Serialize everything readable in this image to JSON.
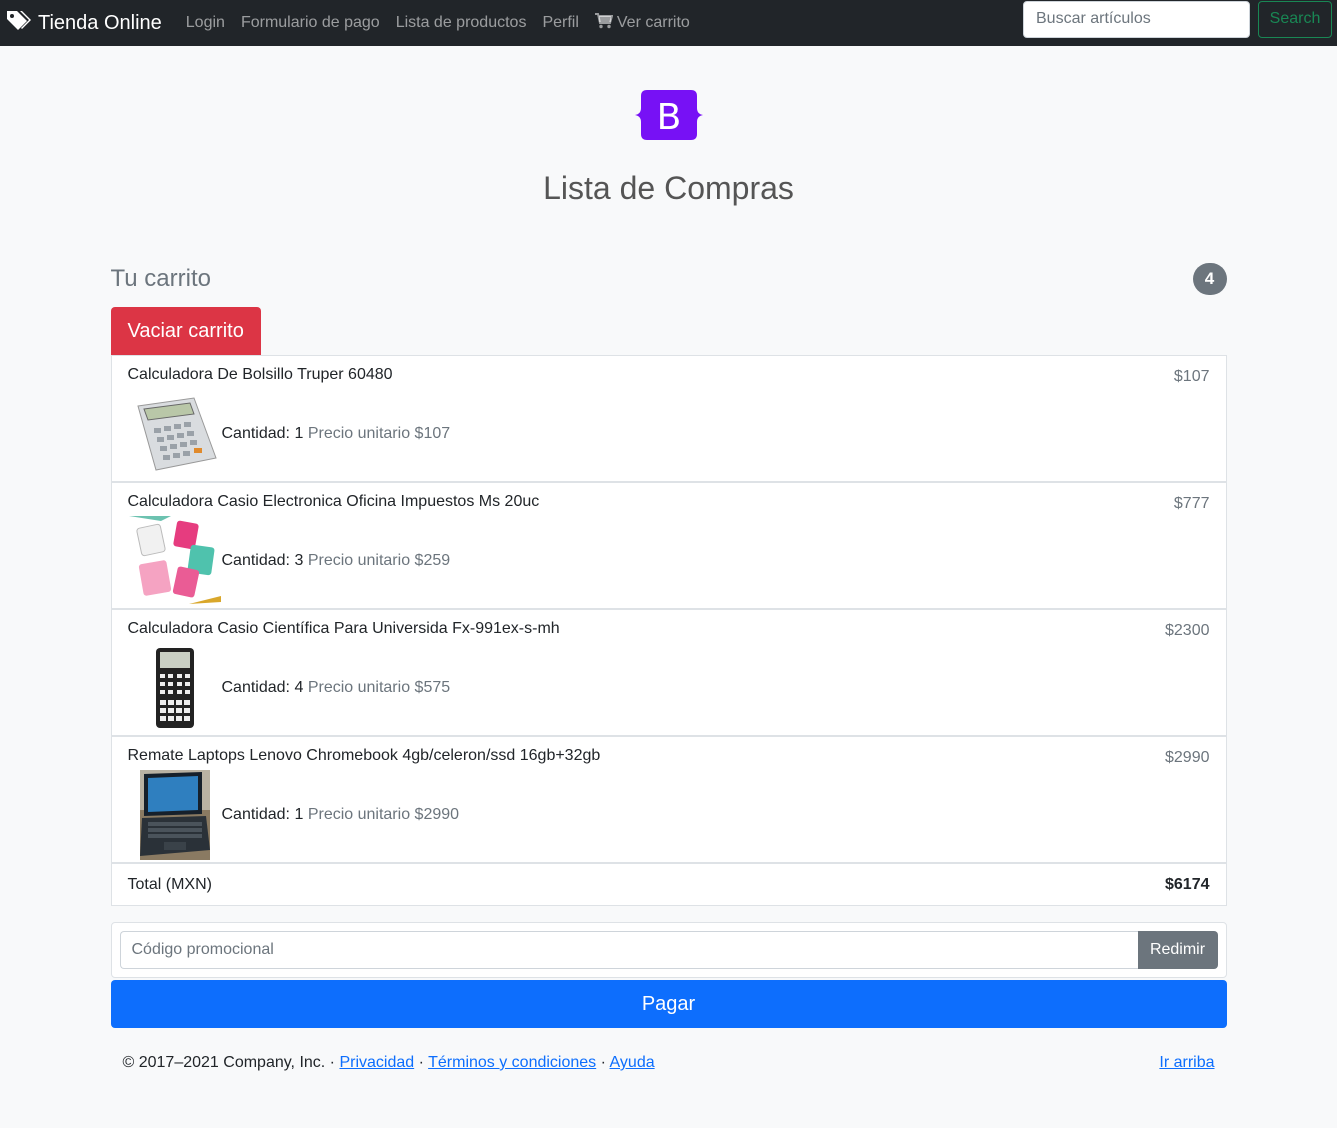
{
  "navbar": {
    "brand": "Tienda Online",
    "brand_icon": "tags-icon",
    "links": [
      "Login",
      "Formulario de pago",
      "Lista de productos",
      "Perfil"
    ],
    "cart_link": "Ver carrito",
    "cart_icon": "cart-icon",
    "search_placeholder": "Buscar artículos",
    "search_button": "Search"
  },
  "header": {
    "logo_letter": "B",
    "logo_color": "#7952b3",
    "title": "Lista de Compras"
  },
  "cart": {
    "title": "Tu carrito",
    "count": "4",
    "empty_button": "Vaciar carrito",
    "items": [
      {
        "name": "Calculadora De Bolsillo Truper 60480",
        "price": "$107",
        "qty_label": "Cantidad:",
        "qty": "1",
        "unit_label": "Precio unitario",
        "unit_price": "$107",
        "image": "calculator-silver"
      },
      {
        "name": "Calculadora Casio Electronica Oficina Impuestos Ms 20uc",
        "price": "$777",
        "qty_label": "Cantidad:",
        "qty": "3",
        "unit_label": "Precio unitario",
        "unit_price": "$259",
        "image": "calculators-colorful"
      },
      {
        "name": "Calculadora Casio Científica Para Universida Fx-991ex-s-mh",
        "price": "$2300",
        "qty_label": "Cantidad:",
        "qty": "4",
        "unit_label": "Precio unitario",
        "unit_price": "$575",
        "image": "scientific-calculator"
      },
      {
        "name": "Remate Laptops Lenovo Chromebook 4gb/celeron/ssd 16gb+32gb",
        "price": "$2990",
        "qty_label": "Cantidad:",
        "qty": "1",
        "unit_label": "Precio unitario",
        "unit_price": "$2990",
        "image": "laptop"
      }
    ],
    "total_label": "Total (MXN)",
    "total_value": "$6174"
  },
  "promo": {
    "placeholder": "Código promocional",
    "button": "Redimir"
  },
  "pay_button": "Pagar",
  "footer": {
    "copyright": "© 2017–2021 Company, Inc. ·",
    "privacy": "Privacidad",
    "sep1": "·",
    "terms": "Términos y condiciones",
    "sep2": "·",
    "help": "Ayuda",
    "top": "Ir arriba"
  }
}
